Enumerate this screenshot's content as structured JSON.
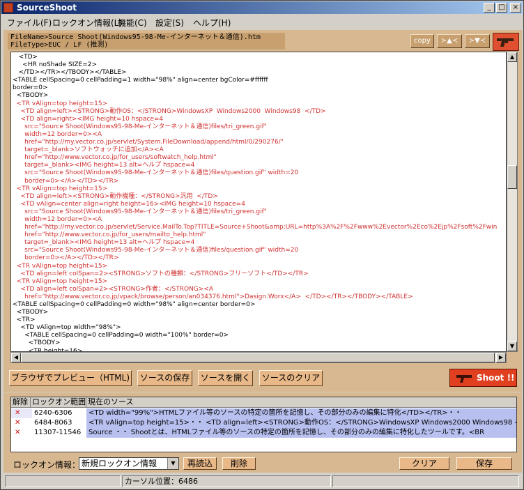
{
  "window": {
    "title": "SourceShoot",
    "minimize": "_",
    "maximize": "□",
    "close": "×"
  },
  "menu": [
    "ファイル(F)",
    "ロックオン情報(L)",
    "機能(C)",
    "設定(S)",
    "ヘルプ(H)"
  ],
  "fileinfo": {
    "filename": "FileName>Source Shoot(Windows95-98-Me-インターネット＆通信).htm",
    "filetype": "FileType>EUC / LF (推測)"
  },
  "toolbar": {
    "copy": "copy",
    "prev": "≻▲≺",
    "next": "≻▼≺"
  },
  "source_lines": [
    {
      "t": "   <TD>",
      "c": "k"
    },
    {
      "t": "     <HR noShade SIZE=2>",
      "c": "k"
    },
    {
      "t": "   </TD></TR></TBODY></TABLE>",
      "c": "k"
    },
    {
      "t": "<TABLE cellSpacing=0 cellPadding=1 width=\"98%\" align=center bgColor=#ffffff",
      "c": "k"
    },
    {
      "t": "border=0>",
      "c": "k"
    },
    {
      "t": "  <TBODY>",
      "c": "k"
    },
    {
      "t": "  <TR vAlign=top height=15>",
      "c": "r"
    },
    {
      "t": "    <TD align=left><STRONG>動作OS：</STRONG>WindowsXP  Windows2000  Windows98  </TD>",
      "c": "r"
    },
    {
      "t": "    <TD align=right><IMG height=10 hspace=4",
      "c": "r"
    },
    {
      "t": "      src=\"Source Shoot(Windows95-98-Me-インターネット＆通信)files/tri_green.gif\"",
      "c": "r"
    },
    {
      "t": "      width=12 border=0><A",
      "c": "r"
    },
    {
      "t": "      href=\"http://my.vector.co.jp/servlet/System.FileDownload/append/html/0/290276/\"",
      "c": "r"
    },
    {
      "t": "      target=_blank>ソフトウォッチに追加</A><A",
      "c": "r"
    },
    {
      "t": "      href=\"http://www.vector.co.jp/for_users/softwatch_help.html\"",
      "c": "r"
    },
    {
      "t": "      target=_blank><IMG height=13 alt=ヘルプ hspace=4",
      "c": "r"
    },
    {
      "t": "      src=\"Source Shoot(Windows95-98-Me-インターネット＆通信)files/question.gif\" width=20",
      "c": "r"
    },
    {
      "t": "      border=0></A></TD></TR>",
      "c": "r"
    },
    {
      "t": "  <TR vAlign=top height=15>",
      "c": "r"
    },
    {
      "t": "    <TD align=left><STRONG>動作機種：</STRONG>汎用  </TD>",
      "c": "r"
    },
    {
      "t": "    <TD vAlign=center align=right height=16><IMG height=10 hspace=4",
      "c": "r"
    },
    {
      "t": "      src=\"Source Shoot(Windows95-98-Me-インターネット＆通信)files/tri_green.gif\"",
      "c": "r"
    },
    {
      "t": "      width=12 border=0><A",
      "c": "r"
    },
    {
      "t": "      href=\"http://my.vector.co.jp/servlet/Service.MailTo.Top?TITLE=Source+Shoot&amp;URL=http%3A%2F%2Fwww%2Evector%2Eco%2Ejp%2Fsoft%2Fwin",
      "c": "r"
    },
    {
      "t": "      href=\"http://www.vector.co.jp/for_users/mailto_help.html\"",
      "c": "r"
    },
    {
      "t": "      target=_blank><IMG height=13 alt=ヘルプ hspace=4",
      "c": "r"
    },
    {
      "t": "      src=\"Source Shoot(Windows95-98-Me-インターネット＆通信)files/question.gif\" width=20",
      "c": "r"
    },
    {
      "t": "      border=0></A></TD></TR>",
      "c": "r"
    },
    {
      "t": "  <TR vAlign=top height=15>",
      "c": "r"
    },
    {
      "t": "    <TD align=left colSpan=2><STRONG>ソフトの種類：</STRONG>フリーソフト</TD></TR>",
      "c": "r"
    },
    {
      "t": "  <TR vAlign=top height=15>",
      "c": "r"
    },
    {
      "t": "    <TD align=left colSpan=2><STRONG>作者：</STRONG><A",
      "c": "r"
    },
    {
      "t": "      href=\"http://www.vector.co.jp/vpack/browse/person/an034376.html\">Dasign.Worx</A>  </TD></TR></TBODY></TABLE>",
      "c": "r"
    },
    {
      "t": "<TABLE cellSpacing=0 cellPadding=0 width=\"98%\" align=center border=0>",
      "c": "k"
    },
    {
      "t": "  <TBODY>",
      "c": "k"
    },
    {
      "t": "  <TR>",
      "c": "k"
    },
    {
      "t": "    <TD vAlign=top width=\"98%\">",
      "c": "k"
    },
    {
      "t": "      <TABLE cellSpacing=0 cellPadding=0 width=\"100%\" border=0>",
      "c": "k"
    },
    {
      "t": "        <TBODY>",
      "c": "k"
    },
    {
      "t": "        <TR height=16>",
      "c": "k"
    }
  ],
  "actions": {
    "preview": "ブラウザでプレビュー（HTML)",
    "save_source": "ソースの保存",
    "open_source": "ソースを開く",
    "clear_source": "ソースのクリア",
    "shoot": "Shoot !!"
  },
  "lock_table": {
    "headers": [
      "解除",
      "ロックオン範囲",
      "現在のソース"
    ],
    "rows": [
      {
        "range": "6240-6306",
        "source": "    <TD width=\"99%\">HTMLファイル等のソースの特定の箇所を記憶し、その部分のみの編集に特化</TD></TR>・・"
      },
      {
        "range": "6484-8063",
        "source": "  <TR vAlign=top height=15>・・   <TD align=left><STRONG>動作OS：</STRONG>WindowsXP  Windows2000  Windows98  </TD>・・"
      },
      {
        "range": "11307-11546",
        "source": "Source ・・        Shootとは、HTMLファイル等のソースの特定の箇所を記憶し、その部分のみの編集に特化したツールです。<BR"
      }
    ]
  },
  "bottom": {
    "label": "ロックオン情報：",
    "dropdown_value": "新規ロックオン情報",
    "reload": "再読込",
    "delete": "削除",
    "clear": "クリア",
    "save": "保存"
  },
  "status": {
    "cursor": "カーソル位置：6486"
  }
}
